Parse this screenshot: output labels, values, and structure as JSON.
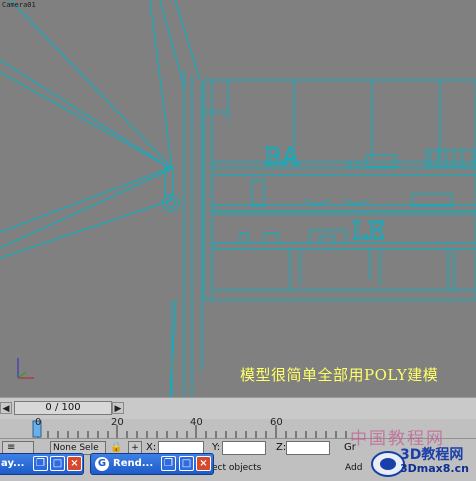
{
  "viewport": {
    "label": "Camera01",
    "caption": "模型很简单全部用POLY建模",
    "shelf_letters_top": "BA",
    "shelf_letters_bottom": "LE"
  },
  "timeline": {
    "frame_display": "0 / 100",
    "prev_icon": "triangle-left-icon",
    "next_icon": "triangle-right-icon"
  },
  "trackbar": {
    "tick_labels": [
      "0",
      "20",
      "40",
      "60"
    ]
  },
  "statusbar": {
    "selection": "None Sele",
    "x_label": "X:",
    "y_label": "Y:",
    "z_label": "Z:",
    "grid_label": "Gr",
    "add_label": "Add",
    "prompt": "ect objects"
  },
  "taskbar": {
    "item1_label": "ay...",
    "item2_label": "Rend..."
  },
  "watermark": {
    "cn_text": "中国教程网",
    "site_name": "3D教程网",
    "url": "3Dmax8.cn"
  },
  "colors": {
    "viewport_bg": "#808080",
    "wireframe": "#00b4c8",
    "caption": "#ffff66",
    "taskbar_blue": "#2a63d4"
  }
}
